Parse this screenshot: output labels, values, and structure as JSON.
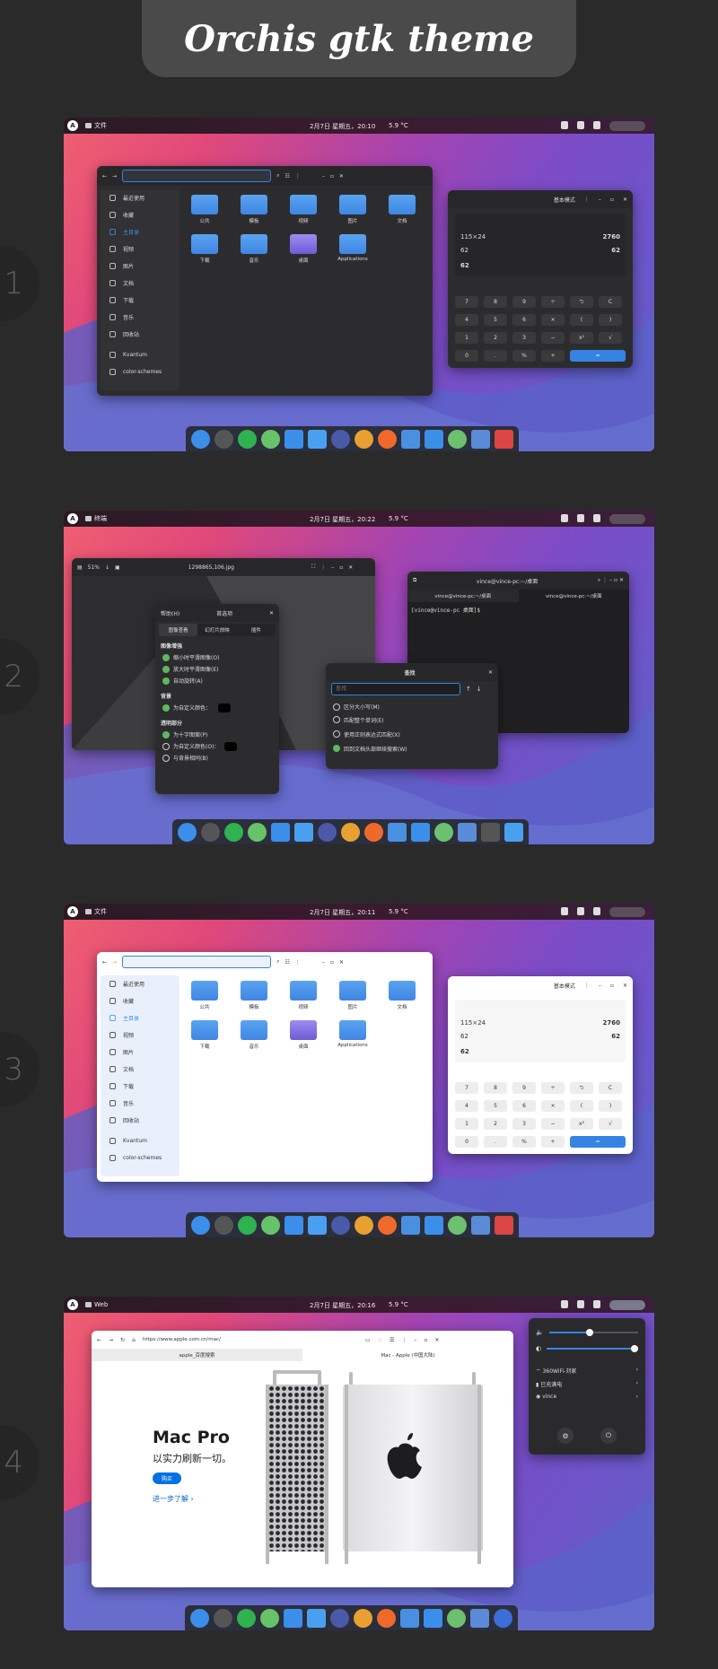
{
  "title": "Orchis gtk theme",
  "numbers": [
    "1",
    "2",
    "3",
    "4"
  ],
  "topbar": {
    "clock1": "2月7日 星期五，20:10",
    "clock2": "2月7日 星期五，20:22",
    "clock3": "2月7日 星期五，20:11",
    "clock4": "2月7日 星期五，20:16",
    "weather": "5.9 °C",
    "app_files": "文件",
    "app_terminal": "终端",
    "app_web": "Web"
  },
  "files": {
    "sidebar": [
      "最近使用",
      "收藏",
      "主目录",
      "视频",
      "图片",
      "文档",
      "下载",
      "音乐",
      "回收站",
      "Kvantum",
      "color-schemes"
    ],
    "folders": [
      "公共",
      "模板",
      "视频",
      "图片",
      "文档",
      "下载",
      "音乐",
      "桌面",
      "Applications"
    ]
  },
  "calc": {
    "mode": "基本模式",
    "line1_expr": "115×24",
    "line1_val": "2760",
    "line2_expr": "62",
    "line2_val": "62",
    "current": "62",
    "keys": [
      "7",
      "8",
      "9",
      "÷",
      "⮌",
      "C",
      "4",
      "5",
      "6",
      "×",
      "(",
      ")",
      "1",
      "2",
      "3",
      "−",
      "x²",
      "√",
      "0",
      ".",
      "%",
      "+",
      "="
    ]
  },
  "viewer": {
    "zoom": "51%",
    "filename": "1298865,106.jpg",
    "prefs_title": "首选项",
    "prefs_help": "帮助(H)",
    "tabs": [
      "图像查看",
      "幻灯片放映",
      "插件"
    ],
    "section_enhance": "图像增强",
    "enhance_opts": [
      "缩小时平滑图像(O)",
      "放大时平滑图像(E)",
      "自动旋转(A)"
    ],
    "section_bg": "背景",
    "bg_opt": "为自定义颜色：",
    "section_alpha": "透明部分",
    "alpha_opts": [
      "为十字图案(P)",
      "为自定义颜色(O)：",
      "与背景相同(B)"
    ]
  },
  "terminal": {
    "title": "vince@vince-pc:~/桌面",
    "tab1": "vince@vince-pc:~/桌面",
    "tab2": "vince@vince-pc:~/桌面",
    "prompt": "[vince@vince-pc 桌面]$"
  },
  "find": {
    "title": "查找",
    "placeholder": "查找",
    "opts": [
      "区分大小写(M)",
      "匹配整个单词(E)",
      "使用正则表达式匹配(X)",
      "回到文档头部继续搜索(W)"
    ]
  },
  "web": {
    "url": "https://www.apple.com.cn/mac/",
    "tab1": "apple_百度搜索",
    "tab2": "Mac - Apple (中国大陆)",
    "product": "Mac Pro",
    "tagline": "以实力刷新一切。",
    "buy": "购买",
    "more": "进一步了解 ›"
  },
  "quick": {
    "wifi": "360WiFi-刘家",
    "battery": "已充满电",
    "user": "vince"
  },
  "colors": {
    "accent": "#3584e4",
    "bg": "#2a2a2b"
  }
}
